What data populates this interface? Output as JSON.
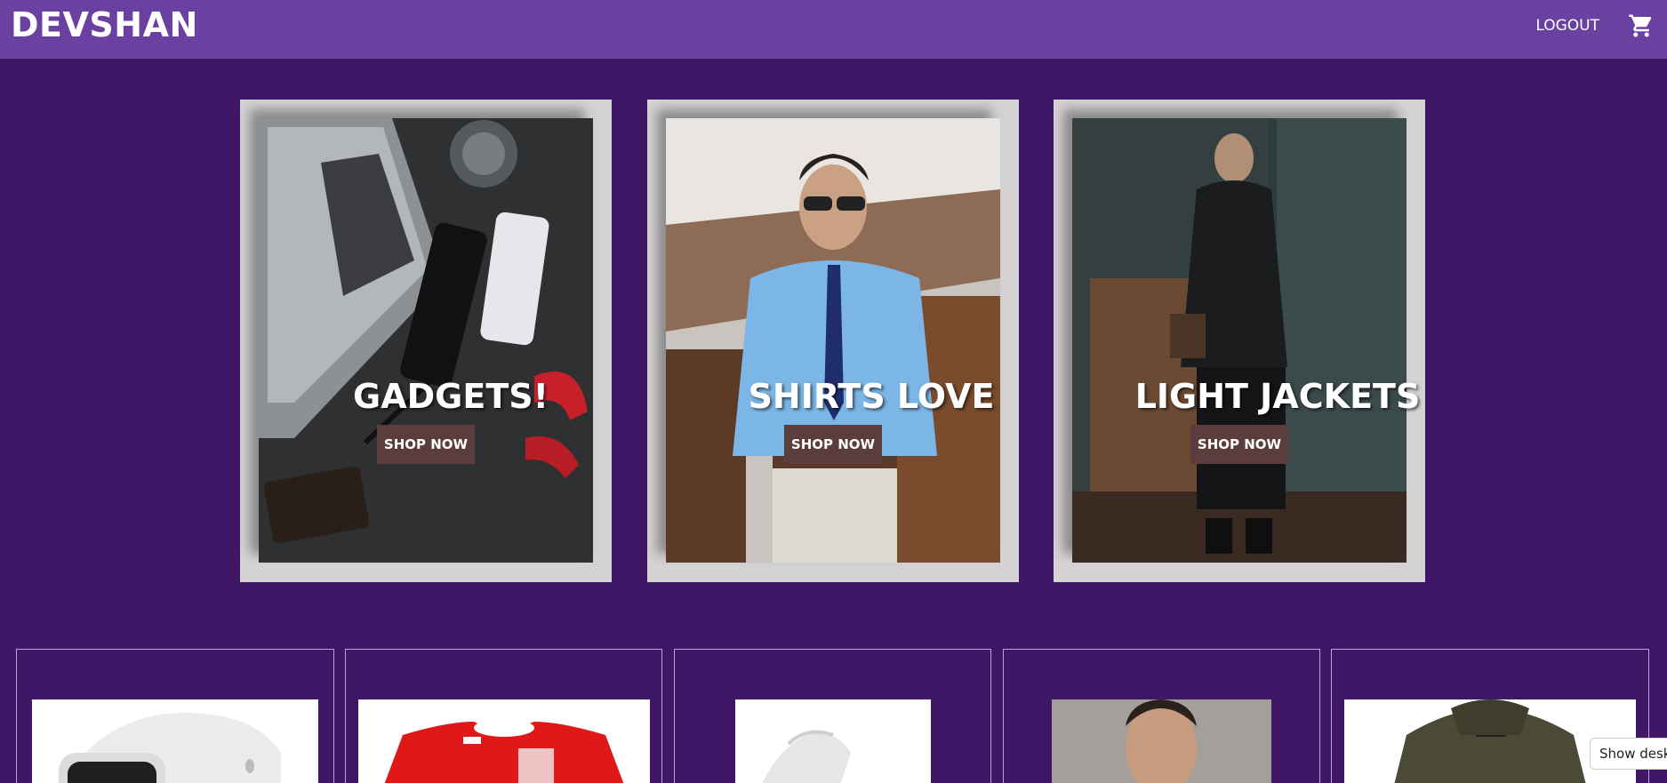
{
  "navbar": {
    "brand": "DEVSHAN",
    "logout_label": "LOGOUT",
    "cart_icon": "shopping-cart-icon"
  },
  "hero_cards": [
    {
      "title": "GADGETS!",
      "button": "SHOP NOW"
    },
    {
      "title": "SHIRTS LOVE",
      "button": "SHOP NOW"
    },
    {
      "title": "LIGHT JACKETS",
      "button": "SHOP NOW"
    }
  ],
  "products": [
    {
      "image": "smart-watch"
    },
    {
      "image": "red-tshirt"
    },
    {
      "image": "white-sneaker"
    },
    {
      "image": "checked-shirt-model"
    },
    {
      "image": "olive-jacket"
    }
  ],
  "tooltip": {
    "text": "Show deskt"
  },
  "colors": {
    "background": "#3f1766",
    "navbar": "#6a41a0",
    "card_frame": "#d4d2d3",
    "button": "#5b3d3d"
  }
}
